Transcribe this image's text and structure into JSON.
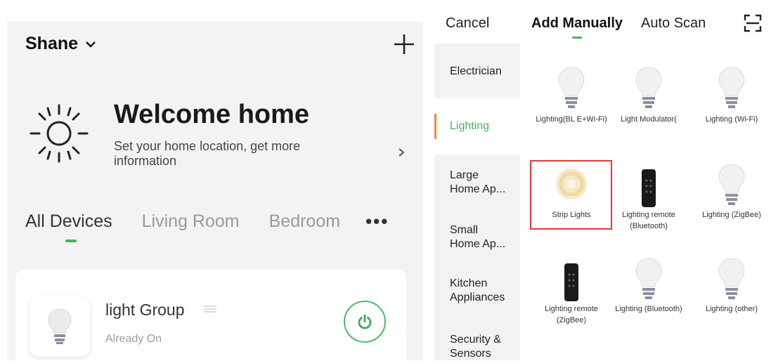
{
  "home": {
    "name": "Shane",
    "welcome_title": "Welcome home",
    "welcome_subtitle": "Set your home location, get more information",
    "tabs": [
      "All Devices",
      "Living Room",
      "Bedroom"
    ],
    "more": "•••",
    "device": {
      "name": "light Group",
      "status": "Already On"
    }
  },
  "add_device": {
    "cancel": "Cancel",
    "tab_manual": "Add Manually",
    "tab_scan": "Auto Scan",
    "categories": [
      "Electrician",
      "Lighting",
      "Large Home Ap...",
      "Small Home Ap...",
      "Kitchen Appliances",
      "Security & Sensors"
    ],
    "selected_category": "Lighting",
    "items": [
      {
        "label": "Lighting(BL E+Wi-Fi)",
        "icon": "bulb-icon"
      },
      {
        "label": "Light Modulator(",
        "icon": "bulb-icon"
      },
      {
        "label": "Lighting (Wi-Fi)",
        "icon": "bulb-icon"
      },
      {
        "label": "Strip Lights",
        "icon": "strip-light-icon"
      },
      {
        "label": "Lighting remote (Bluetooth)",
        "icon": "remote-icon"
      },
      {
        "label": "Lighting (ZigBee)",
        "icon": "bulb-icon"
      },
      {
        "label": "Lighting remote (ZigBee)",
        "icon": "remote-icon"
      },
      {
        "label": "Lighting (Bluetooth)",
        "icon": "bulb-icon"
      },
      {
        "label": "Lighting (other)",
        "icon": "bulb-icon"
      }
    ],
    "highlighted_item": "Strip Lights",
    "accent_color": "#46b35a",
    "highlight_color": "#e53935"
  }
}
